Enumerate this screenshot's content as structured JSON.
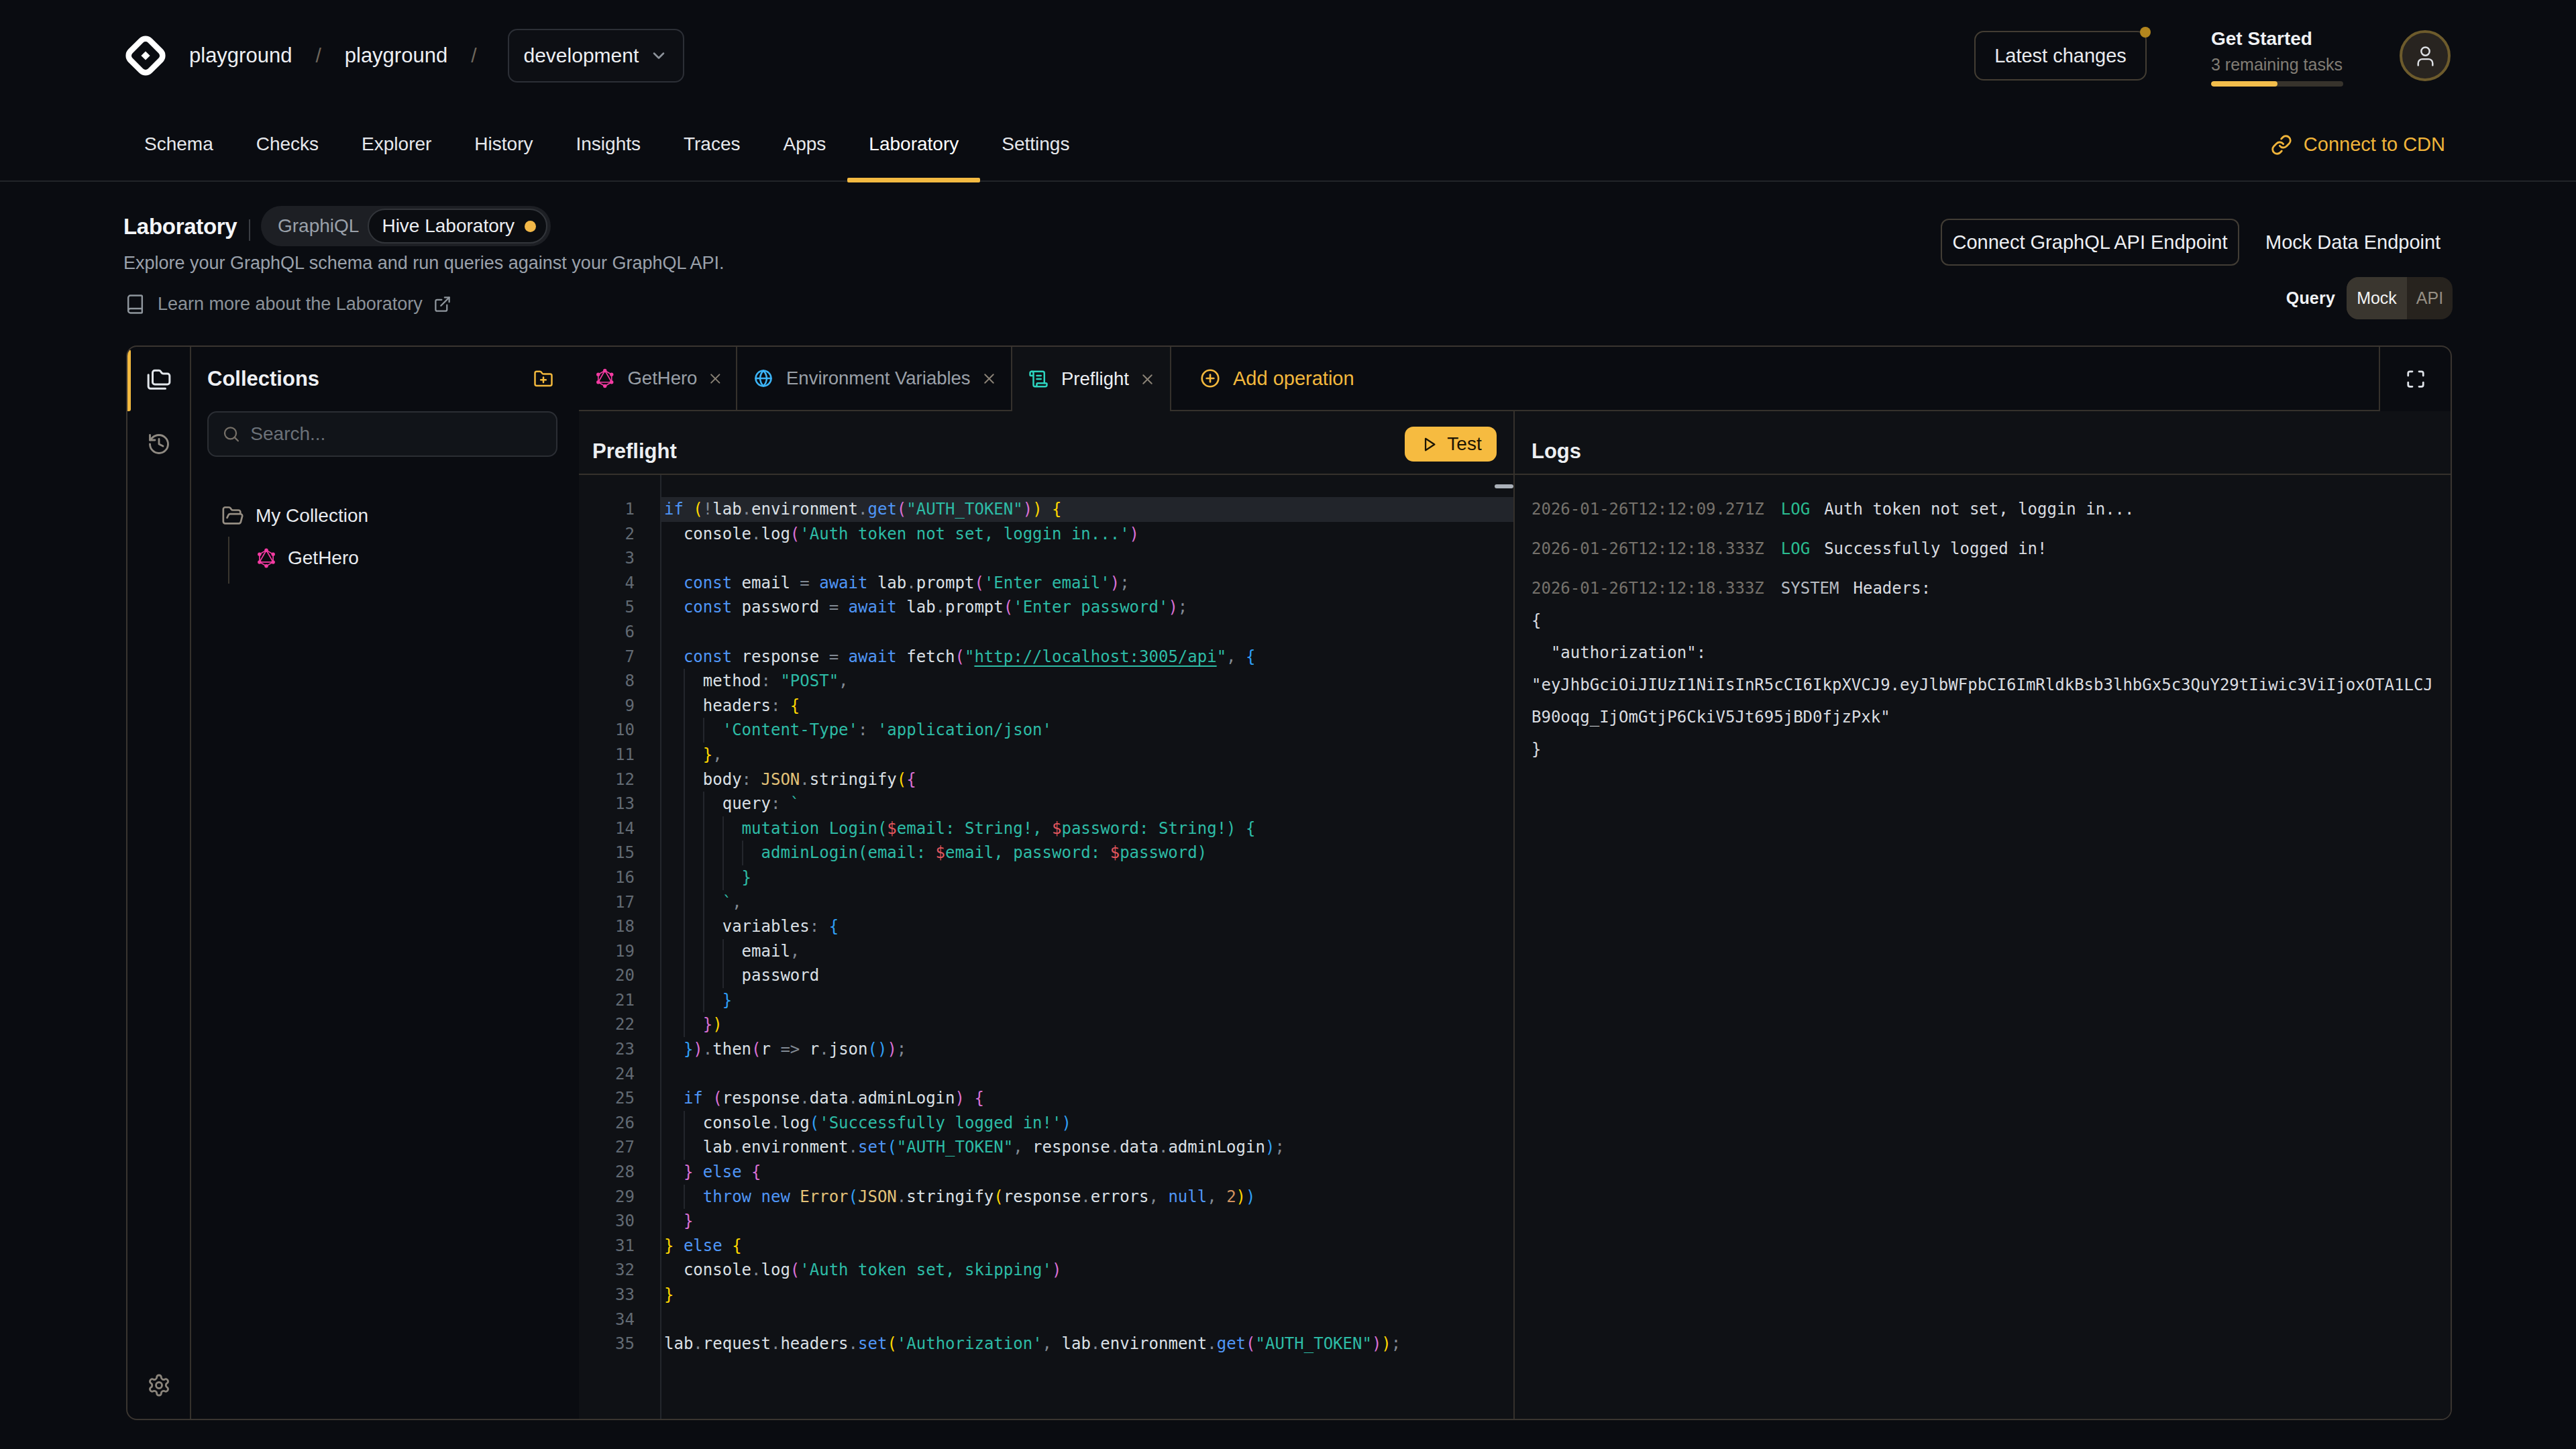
{
  "colors": {
    "accent": "#f2b93f",
    "background": "#0a0c11",
    "panel_border": "#3a3530",
    "graphql_pink": "#f43ba2",
    "globe_blue": "#3cb4f6",
    "preflight_teal": "#2dd4bf",
    "string_teal": "#2dbca6",
    "keyword_blue": "#4f96f7",
    "bracket_gold": "#ffd700",
    "bracket_orchid": "#da70d6",
    "bracket_blue": "#2f9ff5"
  },
  "topbar": {
    "logo": "hive-logo",
    "breadcrumb": {
      "org": "playground",
      "project": "playground",
      "separator": "/"
    },
    "target_selector": {
      "value": "development",
      "icon": "chevron-down-icon"
    },
    "latest_changes_label": "Latest changes",
    "get_started": {
      "title": "Get Started",
      "subtitle": "3 remaining tasks",
      "progress_percent": 50
    },
    "avatar_icon": "user-icon"
  },
  "nav": {
    "items": [
      {
        "label": "Schema",
        "active": false
      },
      {
        "label": "Checks",
        "active": false
      },
      {
        "label": "Explorer",
        "active": false
      },
      {
        "label": "History",
        "active": false
      },
      {
        "label": "Insights",
        "active": false
      },
      {
        "label": "Traces",
        "active": false
      },
      {
        "label": "Apps",
        "active": false
      },
      {
        "label": "Laboratory",
        "active": true
      },
      {
        "label": "Settings",
        "active": false
      }
    ],
    "connect_cdn_label": "Connect to CDN"
  },
  "pagehead": {
    "title": "Laboratory",
    "mode_toggle": {
      "options": [
        "GraphiQL",
        "Hive Laboratory"
      ],
      "selected": "Hive Laboratory"
    },
    "description": "Explore your GraphQL schema and run queries against your GraphQL API.",
    "learn_more_label": "Learn more about the Laboratory",
    "connect_endpoint_label": "Connect GraphQL API Endpoint",
    "mock_endpoint_label": "Mock Data Endpoint",
    "query_label": "Query",
    "endpoint_toggle": {
      "options": [
        "Mock",
        "API"
      ],
      "selected": "Mock"
    }
  },
  "sidebar": {
    "rail": [
      "collections-icon",
      "history-icon",
      "settings-icon"
    ],
    "collections_title": "Collections",
    "new_collection_icon": "folder-plus-icon",
    "search_placeholder": "Search...",
    "tree": {
      "folder": "My Collection",
      "items": [
        {
          "label": "GetHero",
          "icon": "graphql-icon"
        }
      ]
    }
  },
  "tabs": [
    {
      "label": "GetHero",
      "icon": "graphql-icon",
      "active": false,
      "closable": true
    },
    {
      "label": "Environment Variables",
      "icon": "globe-icon",
      "active": false,
      "closable": true
    },
    {
      "label": "Preflight",
      "icon": "scroll-icon",
      "active": true,
      "closable": true
    }
  ],
  "add_operation_label": "Add operation",
  "editor": {
    "title": "Preflight",
    "test_button_label": "Test",
    "active_line": 1,
    "lines": [
      [
        [
          "kw",
          "if"
        ],
        [
          "pl",
          " "
        ],
        [
          "b1",
          "("
        ],
        [
          "pn",
          "!"
        ],
        [
          "pl",
          "lab"
        ],
        [
          "pn",
          "."
        ],
        [
          "pl",
          "environment"
        ],
        [
          "pn",
          "."
        ],
        [
          "kw",
          "get"
        ],
        [
          "b2",
          "("
        ],
        [
          "st",
          "\"AUTH_TOKEN\""
        ],
        [
          "b2",
          ")"
        ],
        [
          "b1",
          ")"
        ],
        [
          "pl",
          " "
        ],
        [
          "b1",
          "{"
        ]
      ],
      [
        [
          "pl",
          "  console"
        ],
        [
          "pn",
          "."
        ],
        [
          "pl",
          "log"
        ],
        [
          "b2",
          "("
        ],
        [
          "st",
          "'Auth token not set, loggin in...'"
        ],
        [
          "b2",
          ")"
        ]
      ],
      [],
      [
        [
          "pl",
          "  "
        ],
        [
          "kw",
          "const"
        ],
        [
          "pl",
          " email "
        ],
        [
          "pn",
          "="
        ],
        [
          "pl",
          " "
        ],
        [
          "kw",
          "await"
        ],
        [
          "pl",
          " lab"
        ],
        [
          "pn",
          "."
        ],
        [
          "pl",
          "prompt"
        ],
        [
          "b2",
          "("
        ],
        [
          "st",
          "'Enter email'"
        ],
        [
          "b2",
          ")"
        ],
        [
          "pn",
          ";"
        ]
      ],
      [
        [
          "pl",
          "  "
        ],
        [
          "kw",
          "const"
        ],
        [
          "pl",
          " password "
        ],
        [
          "pn",
          "="
        ],
        [
          "pl",
          " "
        ],
        [
          "kw",
          "await"
        ],
        [
          "pl",
          " lab"
        ],
        [
          "pn",
          "."
        ],
        [
          "pl",
          "prompt"
        ],
        [
          "b2",
          "("
        ],
        [
          "st",
          "'Enter password'"
        ],
        [
          "b2",
          ")"
        ],
        [
          "pn",
          ";"
        ]
      ],
      [],
      [
        [
          "pl",
          "  "
        ],
        [
          "kw",
          "const"
        ],
        [
          "pl",
          " response "
        ],
        [
          "pn",
          "="
        ],
        [
          "pl",
          " "
        ],
        [
          "kw",
          "await"
        ],
        [
          "pl",
          " fetch"
        ],
        [
          "b2",
          "("
        ],
        [
          "st",
          "\""
        ],
        [
          "du",
          "http://localhost:3005/api"
        ],
        [
          "st",
          "\""
        ],
        [
          "pn",
          ","
        ],
        [
          "pl",
          " "
        ],
        [
          "b3",
          "{"
        ]
      ],
      [
        [
          "pl",
          "    method"
        ],
        [
          "pn",
          ":"
        ],
        [
          "pl",
          " "
        ],
        [
          "st",
          "\"POST\""
        ],
        [
          "pn",
          ","
        ]
      ],
      [
        [
          "pl",
          "    headers"
        ],
        [
          "pn",
          ":"
        ],
        [
          "pl",
          " "
        ],
        [
          "b1",
          "{"
        ]
      ],
      [
        [
          "pl",
          "      "
        ],
        [
          "st",
          "'Content-Type'"
        ],
        [
          "pn",
          ":"
        ],
        [
          "pl",
          " "
        ],
        [
          "st",
          "'application/json'"
        ]
      ],
      [
        [
          "pl",
          "    "
        ],
        [
          "b1",
          "}"
        ],
        [
          "pn",
          ","
        ]
      ],
      [
        [
          "pl",
          "    body"
        ],
        [
          "pn",
          ":"
        ],
        [
          "pl",
          " "
        ],
        [
          "cl",
          "JSON"
        ],
        [
          "pn",
          "."
        ],
        [
          "pl",
          "stringify"
        ],
        [
          "b1",
          "("
        ],
        [
          "b2",
          "{"
        ]
      ],
      [
        [
          "pl",
          "      query"
        ],
        [
          "pn",
          ":"
        ],
        [
          "pl",
          " "
        ],
        [
          "st",
          "`"
        ]
      ],
      [
        [
          "st",
          "        mutation Login("
        ],
        [
          "dl",
          "$"
        ],
        [
          "st",
          "email: String!, "
        ],
        [
          "dl",
          "$"
        ],
        [
          "st",
          "password: String!) {"
        ]
      ],
      [
        [
          "st",
          "          adminLogin(email: "
        ],
        [
          "dl",
          "$"
        ],
        [
          "st",
          "email, password: "
        ],
        [
          "dl",
          "$"
        ],
        [
          "st",
          "password)"
        ]
      ],
      [
        [
          "st",
          "        }"
        ]
      ],
      [
        [
          "st",
          "      `"
        ],
        [
          "pn",
          ","
        ]
      ],
      [
        [
          "pl",
          "      variables"
        ],
        [
          "pn",
          ":"
        ],
        [
          "pl",
          " "
        ],
        [
          "b3",
          "{"
        ]
      ],
      [
        [
          "pl",
          "        email"
        ],
        [
          "pn",
          ","
        ]
      ],
      [
        [
          "pl",
          "        password"
        ]
      ],
      [
        [
          "pl",
          "      "
        ],
        [
          "b3",
          "}"
        ]
      ],
      [
        [
          "pl",
          "    "
        ],
        [
          "b2",
          "}"
        ],
        [
          "b1",
          ")"
        ]
      ],
      [
        [
          "pl",
          "  "
        ],
        [
          "b3",
          "}"
        ],
        [
          "b2",
          ")"
        ],
        [
          "pn",
          "."
        ],
        [
          "pl",
          "then"
        ],
        [
          "b2",
          "("
        ],
        [
          "pl",
          "r "
        ],
        [
          "pn",
          "=>"
        ],
        [
          "pl",
          " r"
        ],
        [
          "pn",
          "."
        ],
        [
          "pl",
          "json"
        ],
        [
          "b3",
          "("
        ],
        [
          "b3",
          ")"
        ],
        [
          "b2",
          ")"
        ],
        [
          "pn",
          ";"
        ]
      ],
      [],
      [
        [
          "pl",
          "  "
        ],
        [
          "kw",
          "if"
        ],
        [
          "pl",
          " "
        ],
        [
          "b2",
          "("
        ],
        [
          "pl",
          "response"
        ],
        [
          "pn",
          "."
        ],
        [
          "pl",
          "data"
        ],
        [
          "pn",
          "."
        ],
        [
          "pl",
          "adminLogin"
        ],
        [
          "b2",
          ")"
        ],
        [
          "pl",
          " "
        ],
        [
          "b2",
          "{"
        ]
      ],
      [
        [
          "pl",
          "    console"
        ],
        [
          "pn",
          "."
        ],
        [
          "pl",
          "log"
        ],
        [
          "b3",
          "("
        ],
        [
          "st",
          "'Successfully logged in!'"
        ],
        [
          "b3",
          ")"
        ]
      ],
      [
        [
          "pl",
          "    lab"
        ],
        [
          "pn",
          "."
        ],
        [
          "pl",
          "environment"
        ],
        [
          "pn",
          "."
        ],
        [
          "kw",
          "set"
        ],
        [
          "b3",
          "("
        ],
        [
          "st",
          "\"AUTH_TOKEN\""
        ],
        [
          "pn",
          ","
        ],
        [
          "pl",
          " response"
        ],
        [
          "pn",
          "."
        ],
        [
          "pl",
          "data"
        ],
        [
          "pn",
          "."
        ],
        [
          "pl",
          "adminLogin"
        ],
        [
          "b3",
          ")"
        ],
        [
          "pn",
          ";"
        ]
      ],
      [
        [
          "pl",
          "  "
        ],
        [
          "b2",
          "}"
        ],
        [
          "pl",
          " "
        ],
        [
          "kw",
          "else"
        ],
        [
          "pl",
          " "
        ],
        [
          "b2",
          "{"
        ]
      ],
      [
        [
          "pl",
          "    "
        ],
        [
          "kw",
          "throw"
        ],
        [
          "pl",
          " "
        ],
        [
          "kw",
          "new"
        ],
        [
          "pl",
          " "
        ],
        [
          "cl",
          "Error"
        ],
        [
          "b3",
          "("
        ],
        [
          "cl",
          "JSON"
        ],
        [
          "pn",
          "."
        ],
        [
          "pl",
          "stringify"
        ],
        [
          "b1",
          "("
        ],
        [
          "pl",
          "response"
        ],
        [
          "pn",
          "."
        ],
        [
          "pl",
          "errors"
        ],
        [
          "pn",
          ","
        ],
        [
          "pl",
          " "
        ],
        [
          "kw",
          "null"
        ],
        [
          "pn",
          ","
        ],
        [
          "pl",
          " "
        ],
        [
          "nm",
          "2"
        ],
        [
          "b1",
          ")"
        ],
        [
          "b3",
          ")"
        ]
      ],
      [
        [
          "pl",
          "  "
        ],
        [
          "b2",
          "}"
        ]
      ],
      [
        [
          "b1",
          "}"
        ],
        [
          "pl",
          " "
        ],
        [
          "kw",
          "else"
        ],
        [
          "pl",
          " "
        ],
        [
          "b1",
          "{"
        ]
      ],
      [
        [
          "pl",
          "  console"
        ],
        [
          "pn",
          "."
        ],
        [
          "pl",
          "log"
        ],
        [
          "b2",
          "("
        ],
        [
          "st",
          "'Auth token set, skipping'"
        ],
        [
          "b2",
          ")"
        ]
      ],
      [
        [
          "b1",
          "}"
        ]
      ],
      [],
      [
        [
          "pl",
          "lab"
        ],
        [
          "pn",
          "."
        ],
        [
          "pl",
          "request"
        ],
        [
          "pn",
          "."
        ],
        [
          "pl",
          "headers"
        ],
        [
          "pn",
          "."
        ],
        [
          "kw",
          "set"
        ],
        [
          "b1",
          "("
        ],
        [
          "st",
          "'Authorization'"
        ],
        [
          "pn",
          ","
        ],
        [
          "pl",
          " lab"
        ],
        [
          "pn",
          "."
        ],
        [
          "pl",
          "environment"
        ],
        [
          "pn",
          "."
        ],
        [
          "kw",
          "get"
        ],
        [
          "b2",
          "("
        ],
        [
          "st",
          "\"AUTH_TOKEN\""
        ],
        [
          "b2",
          ")"
        ],
        [
          "b1",
          ")"
        ],
        [
          "pn",
          ";"
        ]
      ]
    ]
  },
  "logs": {
    "title": "Logs",
    "entries": [
      {
        "ts": "2026-01-26T12:12:09.271Z",
        "tag": "LOG",
        "message": "Auth token not set, loggin in..."
      },
      {
        "ts": "2026-01-26T12:12:18.333Z",
        "tag": "LOG",
        "message": "Successfully logged in!"
      },
      {
        "ts": "2026-01-26T12:12:18.333Z",
        "tag": "SYSTEM",
        "message": "Headers:"
      }
    ],
    "json_payload": "{\n  \"authorization\": \"eyJhbGciOiJIUzI1NiIsInR5cCI6IkpXVCJ9.eyJlbWFpbCI6ImRldkBsb3lhbGx5c3QuY29tIiwic3ViIjoxOTA1LCJB90oqg_IjOmGtjP6CkiV5Jt695jBD0fjzPxk\"\n}"
  }
}
